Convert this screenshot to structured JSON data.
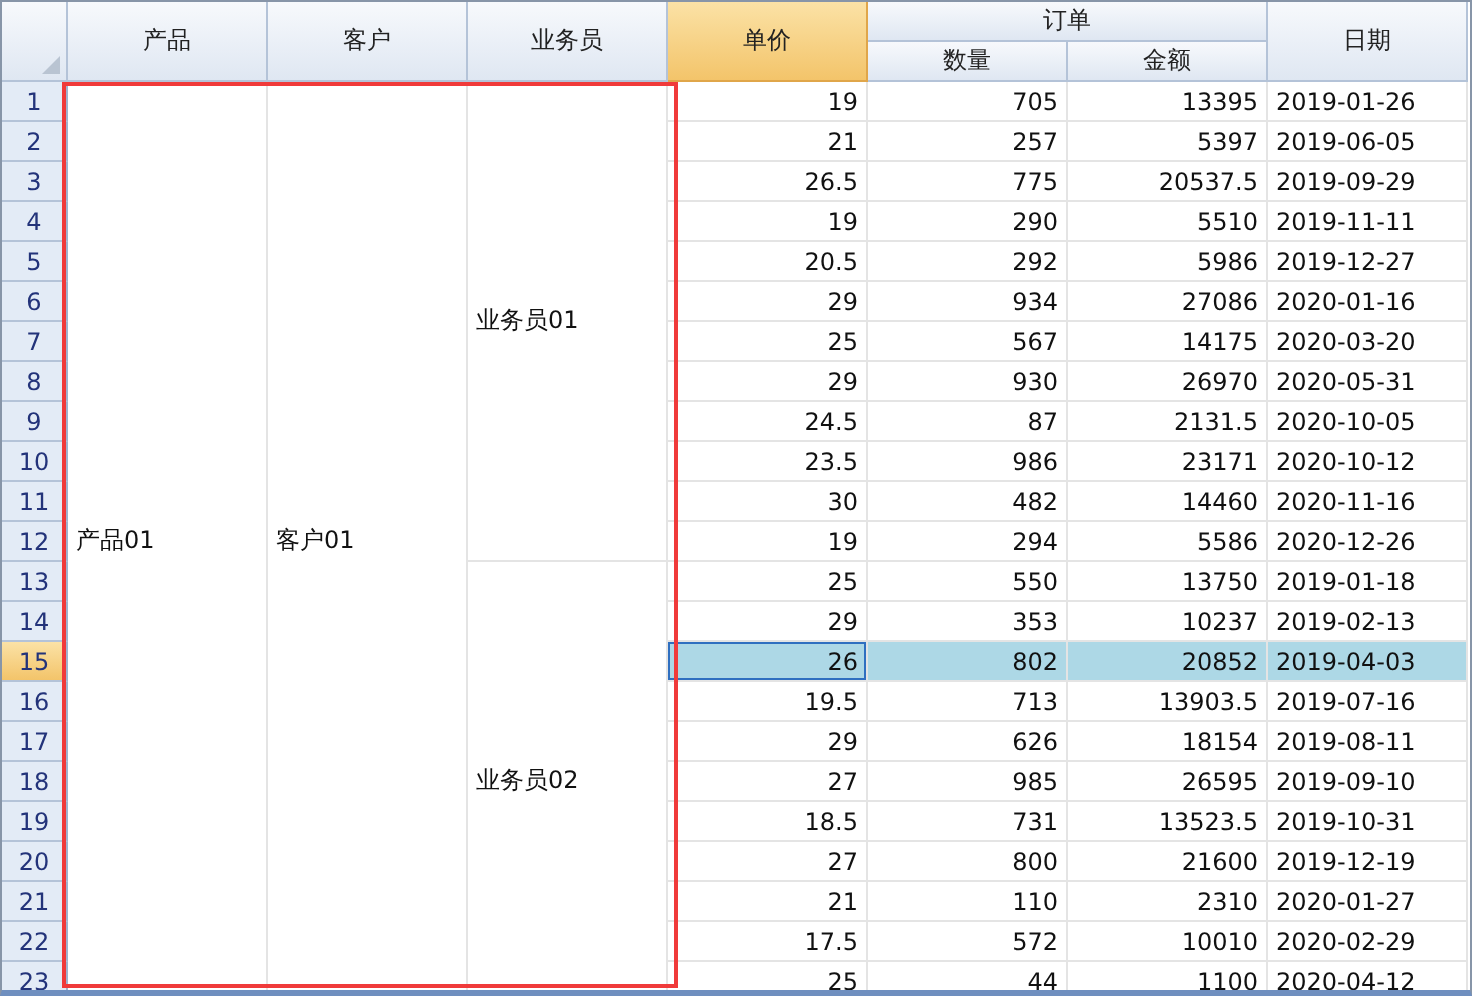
{
  "columns": [
    {
      "kind": "single",
      "label": "产品",
      "selected": false
    },
    {
      "kind": "single",
      "label": "客户",
      "selected": false
    },
    {
      "kind": "single",
      "label": "业务员",
      "selected": false
    },
    {
      "kind": "single",
      "label": "单价",
      "selected": true
    },
    {
      "kind": "group",
      "label": "订单",
      "children": [
        {
          "label": "数量",
          "selected": false
        },
        {
          "label": "金额",
          "selected": false
        }
      ]
    },
    {
      "kind": "single",
      "label": "日期",
      "selected": false
    }
  ],
  "product": "产品01",
  "customer": "客户01",
  "salespeople": [
    {
      "name": "业务员01",
      "rows": [
        {
          "no": "1",
          "price": "19",
          "qty": "705",
          "amount": "13395",
          "date": "2019-01-26",
          "selected": false
        },
        {
          "no": "2",
          "price": "21",
          "qty": "257",
          "amount": "5397",
          "date": "2019-06-05",
          "selected": false
        },
        {
          "no": "3",
          "price": "26.5",
          "qty": "775",
          "amount": "20537.5",
          "date": "2019-09-29",
          "selected": false
        },
        {
          "no": "4",
          "price": "19",
          "qty": "290",
          "amount": "5510",
          "date": "2019-11-11",
          "selected": false
        },
        {
          "no": "5",
          "price": "20.5",
          "qty": "292",
          "amount": "5986",
          "date": "2019-12-27",
          "selected": false
        },
        {
          "no": "6",
          "price": "29",
          "qty": "934",
          "amount": "27086",
          "date": "2020-01-16",
          "selected": false
        },
        {
          "no": "7",
          "price": "25",
          "qty": "567",
          "amount": "14175",
          "date": "2020-03-20",
          "selected": false
        },
        {
          "no": "8",
          "price": "29",
          "qty": "930",
          "amount": "26970",
          "date": "2020-05-31",
          "selected": false
        },
        {
          "no": "9",
          "price": "24.5",
          "qty": "87",
          "amount": "2131.5",
          "date": "2020-10-05",
          "selected": false
        },
        {
          "no": "10",
          "price": "23.5",
          "qty": "986",
          "amount": "23171",
          "date": "2020-10-12",
          "selected": false
        },
        {
          "no": "11",
          "price": "30",
          "qty": "482",
          "amount": "14460",
          "date": "2020-11-16",
          "selected": false
        },
        {
          "no": "12",
          "price": "19",
          "qty": "294",
          "amount": "5586",
          "date": "2020-12-26",
          "selected": false
        }
      ]
    },
    {
      "name": "业务员02",
      "rows": [
        {
          "no": "13",
          "price": "25",
          "qty": "550",
          "amount": "13750",
          "date": "2019-01-18",
          "selected": false
        },
        {
          "no": "14",
          "price": "29",
          "qty": "353",
          "amount": "10237",
          "date": "2019-02-13",
          "selected": false
        },
        {
          "no": "15",
          "price": "26",
          "qty": "802",
          "amount": "20852",
          "date": "2019-04-03",
          "selected": true
        },
        {
          "no": "16",
          "price": "19.5",
          "qty": "713",
          "amount": "13903.5",
          "date": "2019-07-16",
          "selected": false
        },
        {
          "no": "17",
          "price": "29",
          "qty": "626",
          "amount": "18154",
          "date": "2019-08-11",
          "selected": false
        },
        {
          "no": "18",
          "price": "27",
          "qty": "985",
          "amount": "26595",
          "date": "2019-09-10",
          "selected": false
        },
        {
          "no": "19",
          "price": "18.5",
          "qty": "731",
          "amount": "13523.5",
          "date": "2019-10-31",
          "selected": false
        },
        {
          "no": "20",
          "price": "27",
          "qty": "800",
          "amount": "21600",
          "date": "2019-12-19",
          "selected": false
        },
        {
          "no": "21",
          "price": "21",
          "qty": "110",
          "amount": "2310",
          "date": "2020-01-27",
          "selected": false
        },
        {
          "no": "22",
          "price": "17.5",
          "qty": "572",
          "amount": "10010",
          "date": "2020-02-29",
          "selected": false
        },
        {
          "no": "23",
          "price": "25",
          "qty": "44",
          "amount": "1100",
          "date": "2020-04-12",
          "selected": false
        }
      ]
    }
  ]
}
